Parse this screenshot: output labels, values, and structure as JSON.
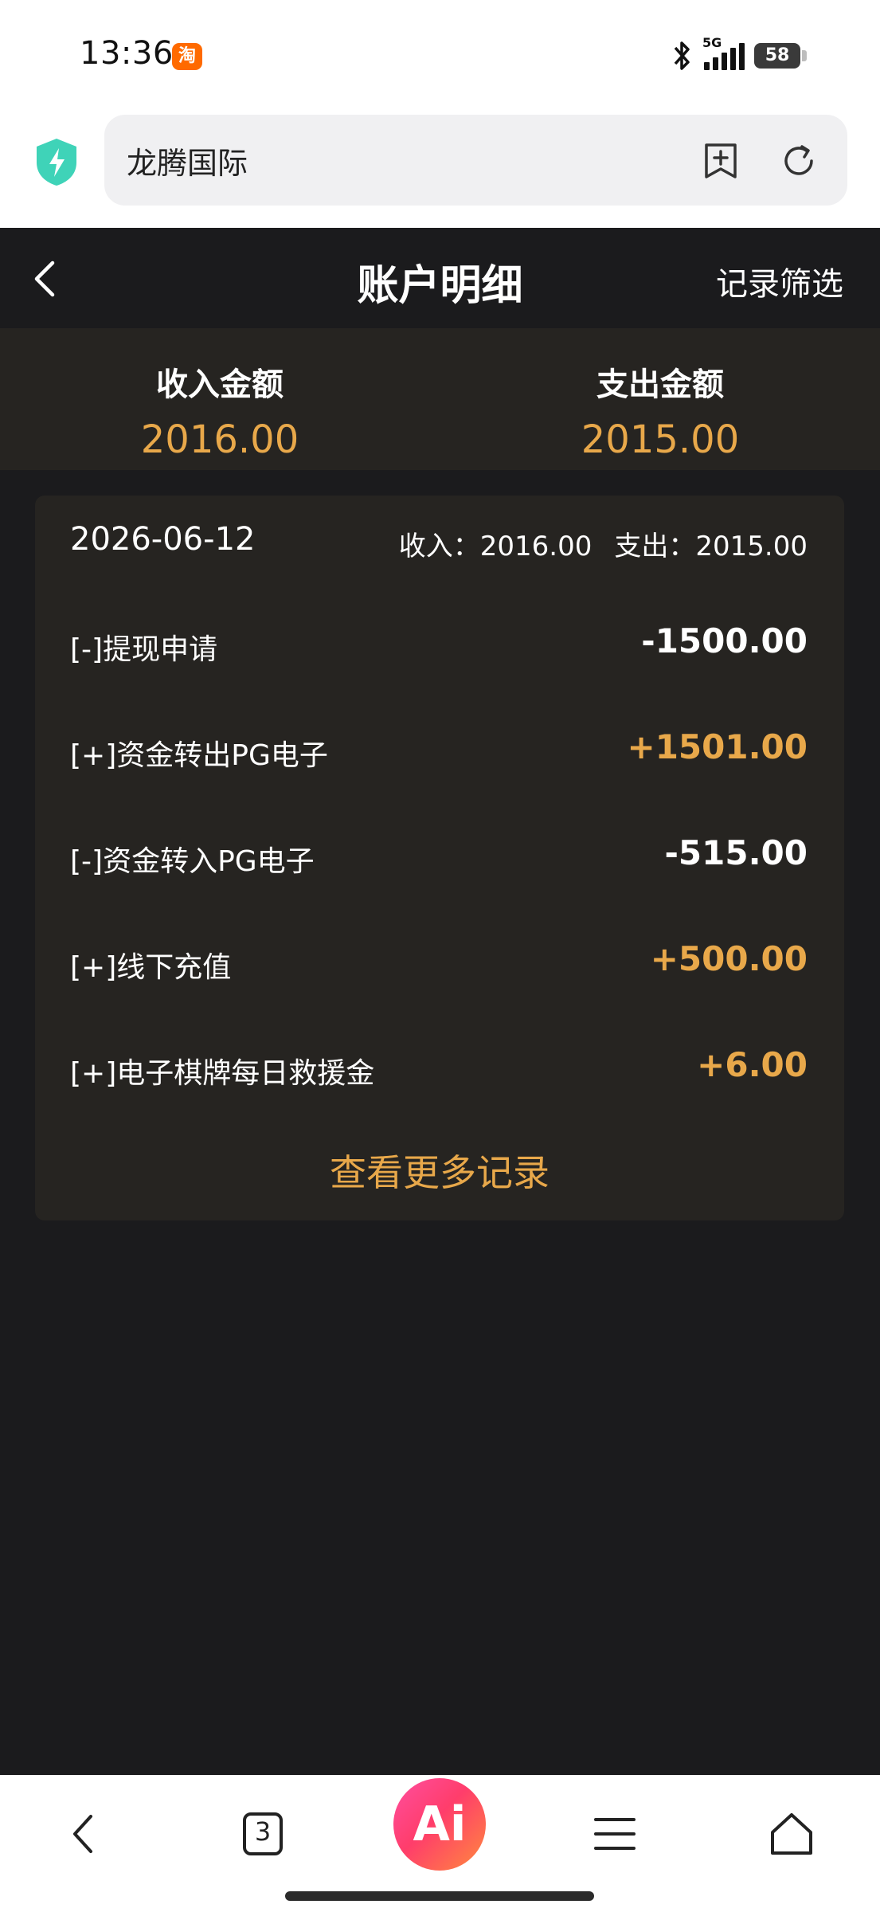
{
  "status_bar": {
    "time": "13:36",
    "app_badge": "淘",
    "network": "5G",
    "battery": "58"
  },
  "browser": {
    "url_text": "龙腾国际"
  },
  "header": {
    "title": "账户明细",
    "filter_label": "记录筛选"
  },
  "summary": {
    "income_label": "收入金额",
    "income_value": "2016.00",
    "expense_label": "支出金额",
    "expense_value": "2015.00"
  },
  "card": {
    "date": "2026-06-12",
    "income_summary": "收入：2016.00",
    "expense_summary": "支出：2015.00",
    "rows": [
      {
        "name": "[-]提现申请",
        "amount": "-1500.00",
        "type": "neg"
      },
      {
        "name": "[+]资金转出PG电子",
        "amount": "+1501.00",
        "type": "pos"
      },
      {
        "name": "[-]资金转入PG电子",
        "amount": "-515.00",
        "type": "neg"
      },
      {
        "name": "[+]线下充值",
        "amount": "+500.00",
        "type": "pos"
      },
      {
        "name": "[+]电子棋牌每日救援金",
        "amount": "+6.00",
        "type": "pos"
      }
    ],
    "more_label": "查看更多记录"
  },
  "bottom_nav": {
    "tab_count": "3",
    "ai_label": "Ai"
  },
  "colors": {
    "accent": "#e8a84a",
    "background": "#1b1b1d",
    "panel": "#262421"
  }
}
